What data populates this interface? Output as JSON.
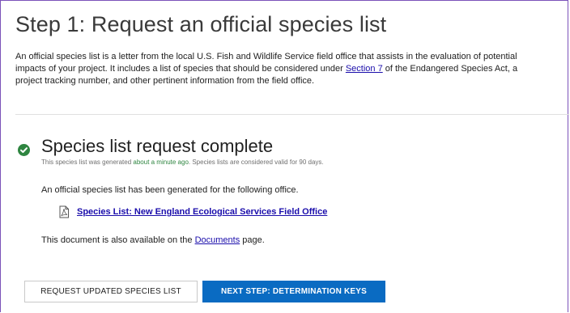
{
  "step": {
    "title": "Step 1: Request an official species list",
    "intro_part1": "An official species list is a letter from the local U.S. Fish and Wildlife Service field office that assists in the evaluation of potential impacts of your project. It includes a list of species that should be considered under ",
    "intro_link": "Section 7",
    "intro_part2": " of the Endangered Species Act, a project tracking number, and other pertinent information from the field office."
  },
  "status": {
    "icon": "check-circle-icon",
    "icon_color": "#2e8540",
    "title": "Species list request complete",
    "sub_part1": "This species list was generated ",
    "sub_ago": "about a minute ago",
    "sub_part2": ". Species lists are considered valid for 90 days."
  },
  "result": {
    "generated_text": "An official species list has been generated for the following office.",
    "file_icon": "pdf-file-icon",
    "species_link": "Species List: New England Ecological Services Field Office",
    "docs_part1": "This document is also available on the ",
    "docs_link": "Documents",
    "docs_part2": " page."
  },
  "actions": {
    "request_updated": "REQUEST UPDATED SPECIES LIST",
    "next_step": "NEXT STEP: DETERMINATION KEYS",
    "primary_color": "#0a6bc2"
  },
  "theme": {
    "frame_border": "#7b52b9",
    "link_color": "#1a0dab"
  }
}
